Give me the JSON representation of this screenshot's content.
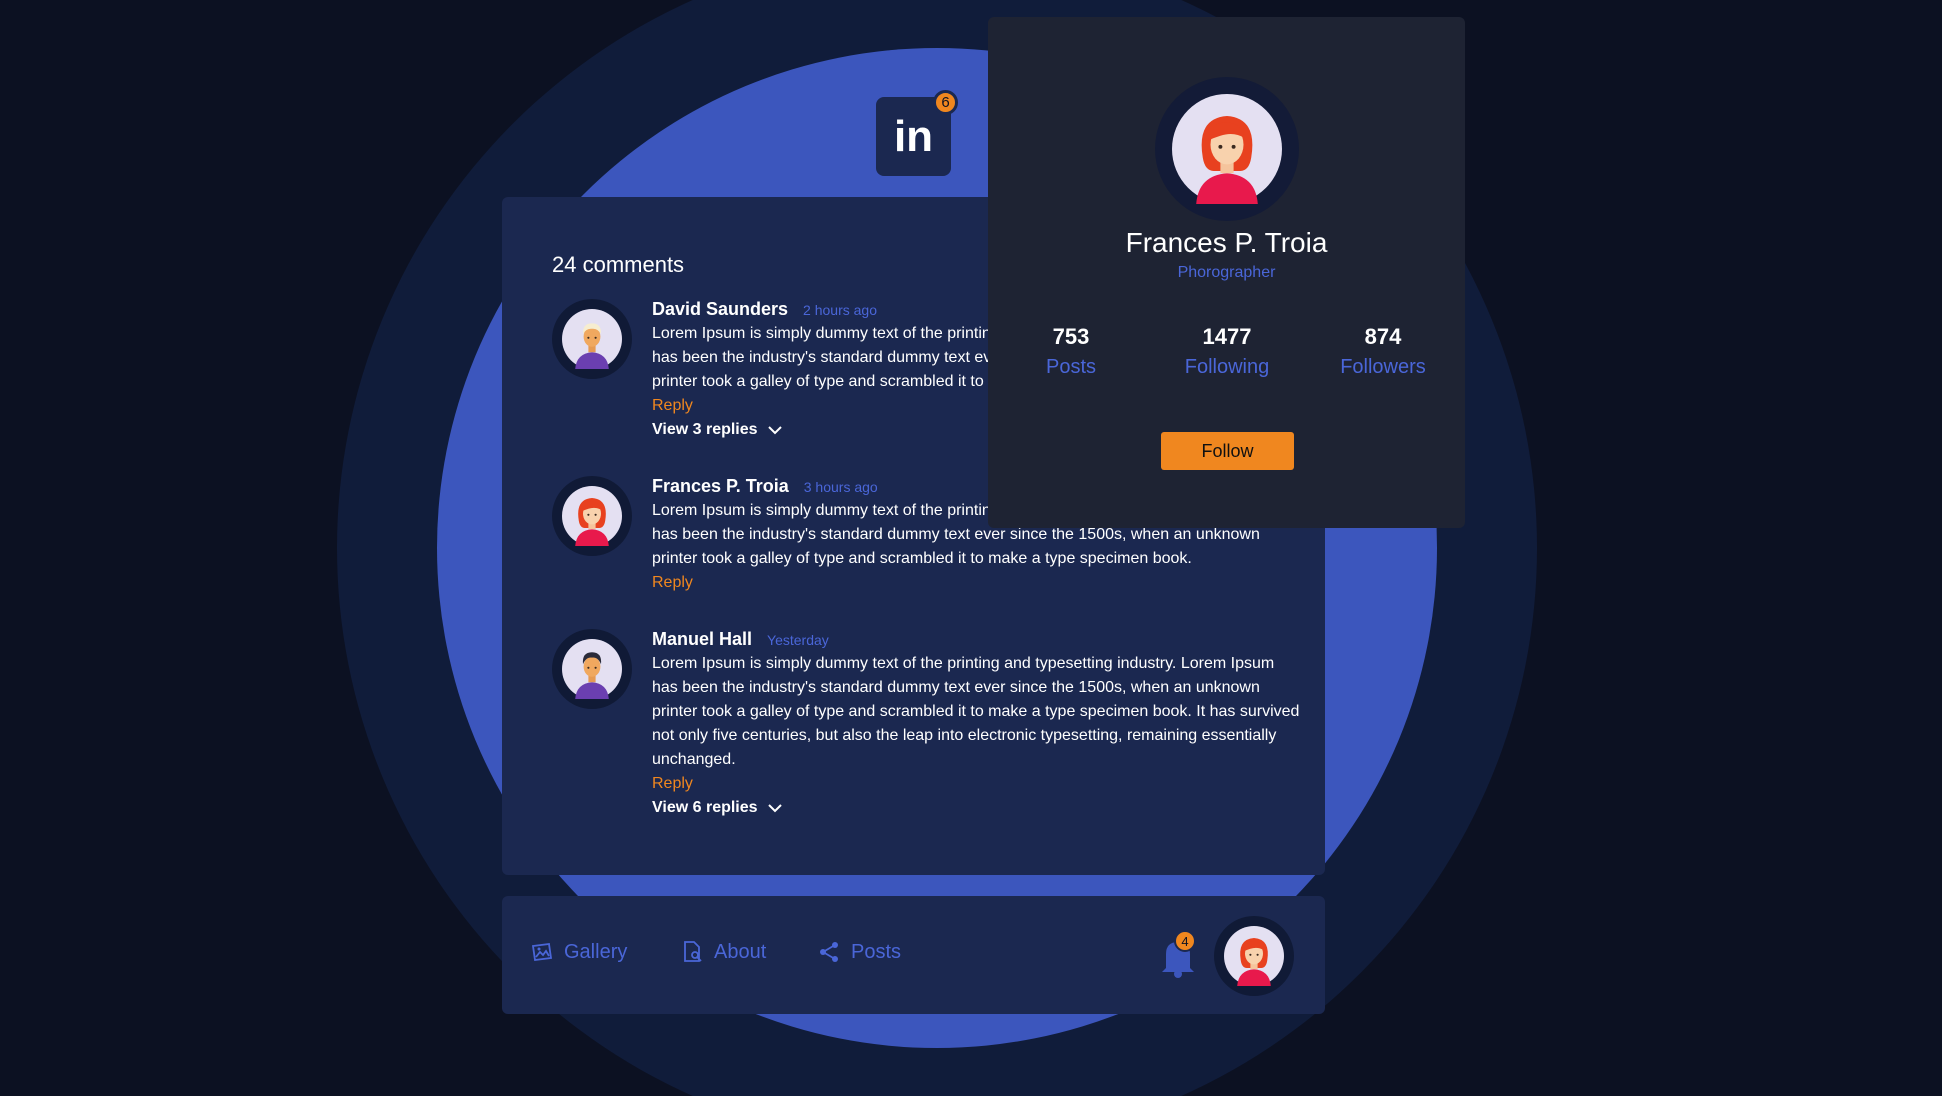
{
  "brand": {
    "logo_text": "in",
    "notification_count": "6"
  },
  "comments": {
    "title": "24 comments",
    "items": [
      {
        "name": "David Saunders",
        "time": "2 hours ago",
        "text": "Lorem Ipsum is simply dummy text of the printing and typesetting industry. Lorem Ipsum has been the industry's standard dummy text ever since the 1500s, when an unknown printer took a galley of type and scrambled it to make a type specimen book.",
        "reply_label": "Reply",
        "replies_label": "View 3 replies",
        "avatar": "man-blond-avatar"
      },
      {
        "name": "Frances P. Troia",
        "time": "3 hours ago",
        "text": "Lorem Ipsum is simply dummy text of the printing and typesetting industry. Lorem Ipsum has been the industry's standard dummy text ever since the 1500s, when an unknown printer took a galley of type and scrambled it to make a type specimen book.",
        "reply_label": "Reply",
        "avatar": "woman-redhead-avatar"
      },
      {
        "name": "Manuel Hall",
        "time": "Yesterday",
        "text": "Lorem Ipsum is simply dummy text of the printing and typesetting industry. Lorem Ipsum has been the industry's standard dummy text ever since the 1500s, when an unknown printer took a galley of type and scrambled it to make a type specimen book. It has survived not only five centuries, but also the leap into electronic typesetting, remaining essentially unchanged.",
        "reply_label": "Reply",
        "replies_label": "View 6 replies",
        "avatar": "man-dark-hair-avatar"
      }
    ]
  },
  "profile": {
    "name": "Frances P. Troia",
    "role": "Phorographer",
    "stats": [
      {
        "value": "753",
        "label": "Posts"
      },
      {
        "value": "1477",
        "label": "Following"
      },
      {
        "value": "874",
        "label": "Followers"
      }
    ],
    "follow_label": "Follow"
  },
  "nav": {
    "items": [
      {
        "label": "Gallery",
        "icon": "gallery-icon"
      },
      {
        "label": "About",
        "icon": "document-icon"
      },
      {
        "label": "Posts",
        "icon": "share-icon"
      }
    ],
    "notification_count": "4"
  },
  "colors": {
    "background": "#0c1122",
    "card": "#1b2850",
    "profile_card": "#1e2333",
    "accent": "#f0871f",
    "link_blue": "#4a66d8",
    "circle_blue": "#3c56bd"
  }
}
